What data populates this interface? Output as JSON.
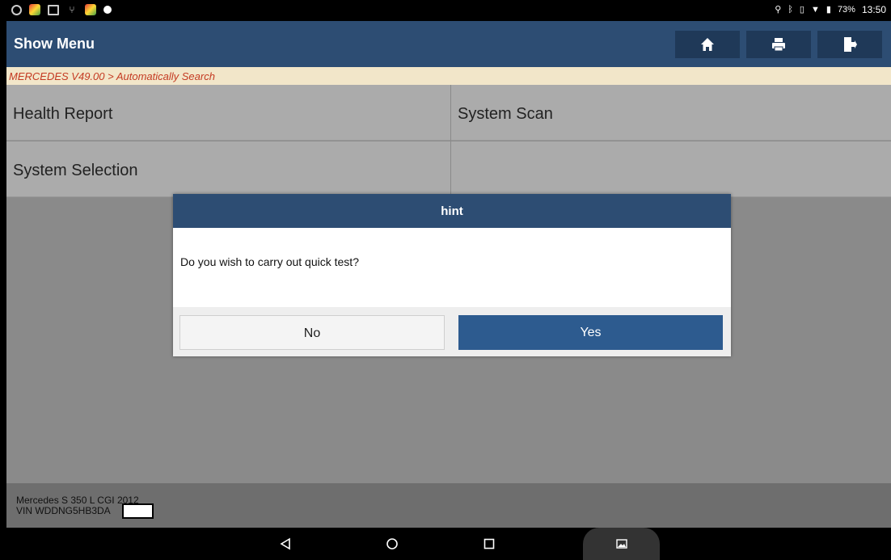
{
  "status_bar": {
    "battery": "73%",
    "time": "13:50",
    "left_icons": [
      "alarm-icon",
      "app-icon",
      "screen-icon",
      "usb-icon",
      "app-icon",
      "pointer-icon"
    ],
    "right_icons": [
      "location-icon",
      "bluetooth-icon",
      "vibrate-icon",
      "wifi-icon",
      "battery-icon"
    ]
  },
  "header": {
    "title": "Show Menu",
    "buttons": [
      "home-icon",
      "print-icon",
      "exit-icon"
    ]
  },
  "breadcrumb": "MERCEDES V49.00 > Automatically Search",
  "menu": {
    "items": [
      "Health Report",
      "System Scan",
      "System Selection",
      ""
    ]
  },
  "dialog": {
    "title": "hint",
    "message": "Do you wish to carry out quick test?",
    "no_label": "No",
    "yes_label": "Yes"
  },
  "footer": {
    "vehicle": "Mercedes S 350 L CGI 2012",
    "vin": "VIN WDDNG5HB3DA"
  },
  "colors": {
    "header_bg": "#2d4d73",
    "breadcrumb_text": "#c43a22",
    "yes_button": "#2d5b8f"
  }
}
